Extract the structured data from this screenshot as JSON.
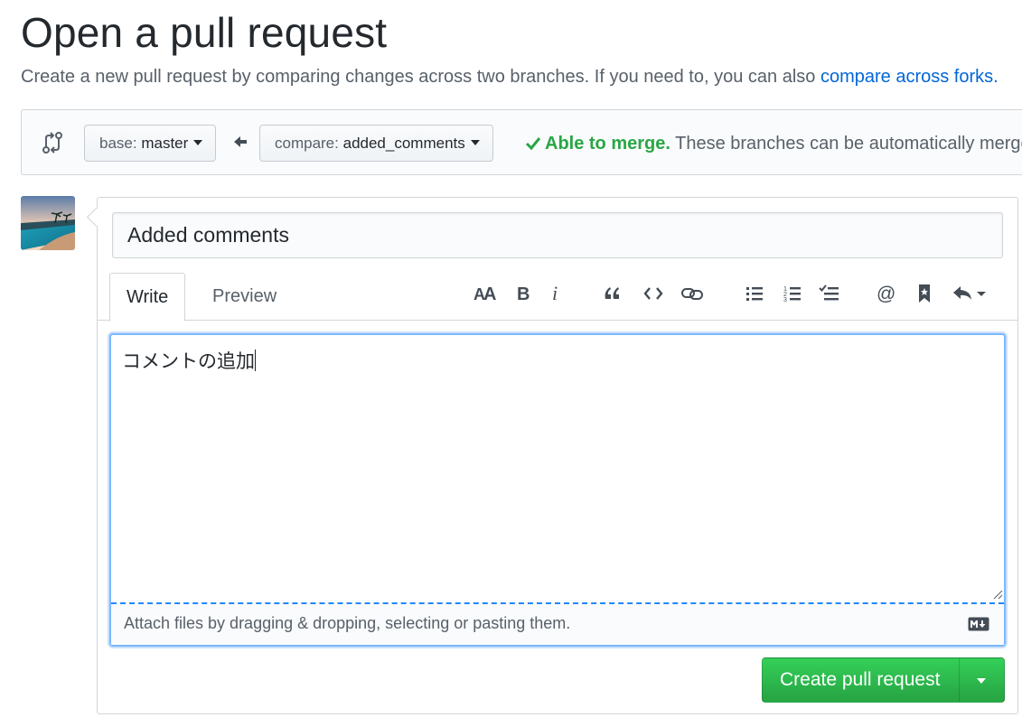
{
  "page": {
    "title": "Open a pull request",
    "subtitle": "Create a new pull request by comparing changes across two branches. If you need to, you can also ",
    "subtitle_link": "compare across forks."
  },
  "range": {
    "base_prefix": "base:",
    "base_branch": "master",
    "compare_prefix": "compare:",
    "compare_branch": "added_comments",
    "merge_ok": "Able to merge.",
    "merge_detail": "These branches can be automatically merged."
  },
  "form": {
    "title_value": "Added comments",
    "tabs": [
      {
        "label": "Write"
      },
      {
        "label": "Preview"
      }
    ],
    "body_text": "コメントの追加",
    "attach_hint": "Attach files by dragging & dropping, selecting or pasting them.",
    "submit_label": "Create pull request"
  },
  "toolbar": [
    {
      "icon": "text-size-icon"
    },
    {
      "icon": "bold-icon"
    },
    {
      "icon": "italic-icon"
    },
    {
      "icon": "quote-icon"
    },
    {
      "icon": "code-icon"
    },
    {
      "icon": "link-icon"
    },
    {
      "icon": "bulleted-list-icon"
    },
    {
      "icon": "numbered-list-icon"
    },
    {
      "icon": "task-list-icon"
    },
    {
      "icon": "mention-icon"
    },
    {
      "icon": "bookmark-icon"
    },
    {
      "icon": "reply-icon"
    }
  ],
  "colors": {
    "accent_link": "#0366d6",
    "merge_green": "#28a745",
    "focus_blue": "#79b8ff"
  }
}
